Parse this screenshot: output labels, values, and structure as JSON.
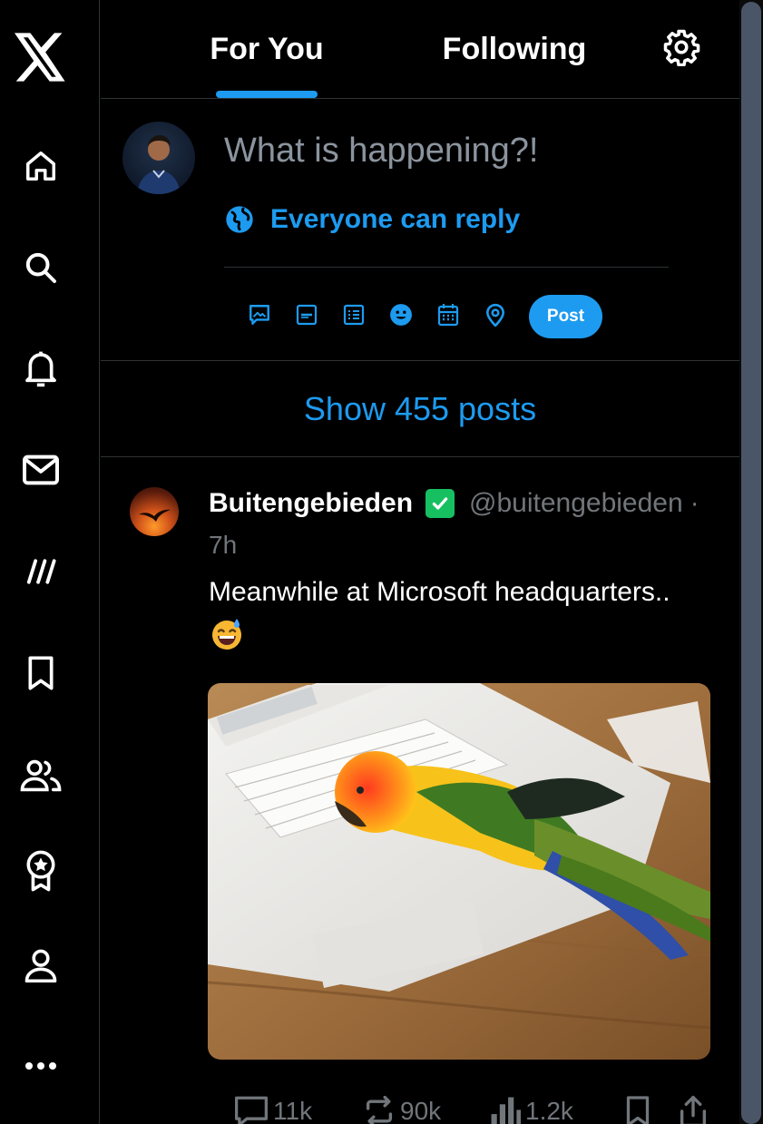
{
  "brand": {
    "logo_icon": "x-logo-icon",
    "accent": "#1d9bf0"
  },
  "sidebar": {
    "items": [
      {
        "id": "home",
        "icon": "home-icon"
      },
      {
        "id": "explore",
        "icon": "search-icon"
      },
      {
        "id": "notifications",
        "icon": "bell-icon"
      },
      {
        "id": "messages",
        "icon": "mail-icon"
      },
      {
        "id": "grok",
        "icon": "slash-icon"
      },
      {
        "id": "bookmarks",
        "icon": "bookmark-icon"
      },
      {
        "id": "communities",
        "icon": "people-icon"
      },
      {
        "id": "premium",
        "icon": "badge-icon"
      },
      {
        "id": "profile",
        "icon": "person-icon"
      },
      {
        "id": "more",
        "icon": "more-icon"
      }
    ]
  },
  "header": {
    "tabs": [
      {
        "label": "For You",
        "active": true
      },
      {
        "label": "Following",
        "active": false
      }
    ]
  },
  "composer": {
    "placeholder": "What is happening?!",
    "reply_setting": "Everyone can reply",
    "tools": [
      "media-icon",
      "gif-icon",
      "poll-icon",
      "emoji-icon",
      "schedule-icon",
      "location-icon"
    ],
    "post_label": "Post"
  },
  "feed": {
    "show_new_posts": "Show 455 posts",
    "posts": [
      {
        "display_name": "Buitengebieden",
        "handle": "@buitengebieden",
        "separator": "·",
        "time": "7h",
        "verified_color": "#16c060",
        "text": "Meanwhile at Microsoft headquarters..",
        "emoji": "grinning-sweat-emoji",
        "media": "parrot-on-laptop-photo",
        "stats": {
          "replies": "11k",
          "reposts": "90k",
          "views": "1.2k"
        }
      }
    ]
  }
}
